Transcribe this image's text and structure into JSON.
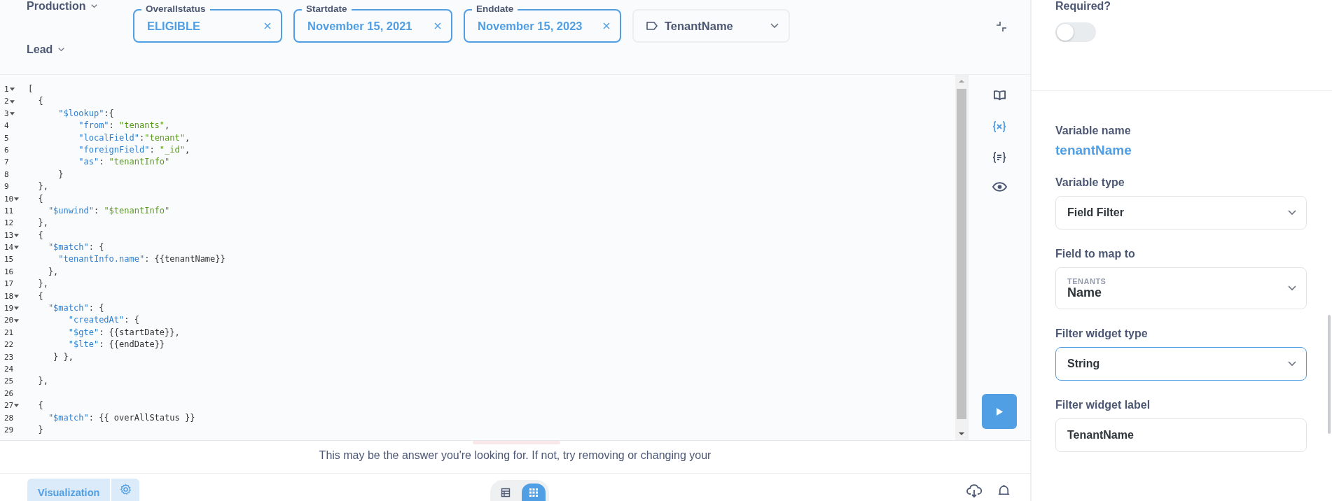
{
  "sidebar_filters": [
    {
      "label": "Production"
    },
    {
      "label": "Lead"
    }
  ],
  "filter_widgets": [
    {
      "kind": "chip",
      "label": "Overallstatus",
      "value": "ELIGIBLE"
    },
    {
      "kind": "chip",
      "label": "Startdate",
      "value": "November 15, 2021"
    },
    {
      "kind": "chip",
      "label": "Enddate",
      "value": "November 15, 2023"
    },
    {
      "kind": "dropdown",
      "value": "TenantName"
    }
  ],
  "editor": {
    "lines": [
      {
        "number": "1",
        "fold": true,
        "tokens": [
          {
            "kind": "punct",
            "text": "["
          }
        ]
      },
      {
        "number": "2",
        "fold": true,
        "tokens": [
          {
            "kind": "punct",
            "text": "  {"
          }
        ]
      },
      {
        "number": "3",
        "fold": true,
        "tokens": [
          {
            "kind": "key",
            "text": "      \"$lookup\""
          },
          {
            "kind": "punct",
            "text": ":{"
          }
        ]
      },
      {
        "number": "4",
        "fold": false,
        "tokens": [
          {
            "kind": "key",
            "text": "          \"from\""
          },
          {
            "kind": "punct",
            "text": ": "
          },
          {
            "kind": "string",
            "text": "\"tenants\""
          },
          {
            "kind": "punct",
            "text": ","
          }
        ]
      },
      {
        "number": "5",
        "fold": false,
        "tokens": [
          {
            "kind": "key",
            "text": "          \"localField\""
          },
          {
            "kind": "punct",
            "text": ":"
          },
          {
            "kind": "string",
            "text": "\"tenant\""
          },
          {
            "kind": "punct",
            "text": ","
          }
        ]
      },
      {
        "number": "6",
        "fold": false,
        "tokens": [
          {
            "kind": "key",
            "text": "          \"foreignField\""
          },
          {
            "kind": "punct",
            "text": ": "
          },
          {
            "kind": "string",
            "text": "\"_id\""
          },
          {
            "kind": "punct",
            "text": ","
          }
        ]
      },
      {
        "number": "7",
        "fold": false,
        "tokens": [
          {
            "kind": "key",
            "text": "          \"as\""
          },
          {
            "kind": "punct",
            "text": ": "
          },
          {
            "kind": "string",
            "text": "\"tenantInfo\""
          }
        ]
      },
      {
        "number": "8",
        "fold": false,
        "tokens": [
          {
            "kind": "punct",
            "text": "      }"
          }
        ]
      },
      {
        "number": "9",
        "fold": false,
        "tokens": [
          {
            "kind": "punct",
            "text": "  },"
          }
        ]
      },
      {
        "number": "10",
        "fold": true,
        "tokens": [
          {
            "kind": "punct",
            "text": "  {"
          }
        ]
      },
      {
        "number": "11",
        "fold": false,
        "tokens": [
          {
            "kind": "key",
            "text": "    \"$unwind\""
          },
          {
            "kind": "punct",
            "text": ": "
          },
          {
            "kind": "string",
            "text": "\"$tenantInfo\""
          }
        ]
      },
      {
        "number": "12",
        "fold": false,
        "tokens": [
          {
            "kind": "punct",
            "text": "  },"
          }
        ]
      },
      {
        "number": "13",
        "fold": true,
        "tokens": [
          {
            "kind": "punct",
            "text": "  {"
          }
        ]
      },
      {
        "number": "14",
        "fold": true,
        "tokens": [
          {
            "kind": "key",
            "text": "    \"$match\""
          },
          {
            "kind": "punct",
            "text": ": {"
          }
        ]
      },
      {
        "number": "15",
        "fold": false,
        "tokens": [
          {
            "kind": "key",
            "text": "      \"tenantInfo.name\""
          },
          {
            "kind": "punct",
            "text": ": {{tenantName}}"
          }
        ]
      },
      {
        "number": "16",
        "fold": false,
        "tokens": [
          {
            "kind": "punct",
            "text": "    },"
          }
        ]
      },
      {
        "number": "17",
        "fold": false,
        "tokens": [
          {
            "kind": "punct",
            "text": "  },"
          }
        ]
      },
      {
        "number": "18",
        "fold": true,
        "tokens": [
          {
            "kind": "punct",
            "text": "  {"
          }
        ]
      },
      {
        "number": "19",
        "fold": true,
        "tokens": [
          {
            "kind": "key",
            "text": "    \"$match\""
          },
          {
            "kind": "punct",
            "text": ": {"
          }
        ]
      },
      {
        "number": "20",
        "fold": true,
        "tokens": [
          {
            "kind": "key",
            "text": "        \"createdAt\""
          },
          {
            "kind": "punct",
            "text": ": {"
          }
        ]
      },
      {
        "number": "21",
        "fold": false,
        "tokens": [
          {
            "kind": "key",
            "text": "        \"$gte\""
          },
          {
            "kind": "punct",
            "text": ": {{startDate}},"
          }
        ]
      },
      {
        "number": "22",
        "fold": false,
        "tokens": [
          {
            "kind": "key",
            "text": "        \"$lte\""
          },
          {
            "kind": "punct",
            "text": ": {{endDate}}"
          }
        ]
      },
      {
        "number": "23",
        "fold": false,
        "tokens": [
          {
            "kind": "punct",
            "text": "     } },"
          }
        ]
      },
      {
        "number": "24",
        "fold": false
      },
      {
        "number": "25",
        "fold": false,
        "tokens": [
          {
            "kind": "punct",
            "text": "  },"
          }
        ]
      },
      {
        "number": "26",
        "fold": false
      },
      {
        "number": "27",
        "fold": true,
        "tokens": [
          {
            "kind": "punct",
            "text": "  {"
          }
        ]
      },
      {
        "number": "28",
        "fold": false,
        "tokens": [
          {
            "kind": "key",
            "text": "    \"$match\""
          },
          {
            "kind": "punct",
            "text": ": {{ overAllStatus }}"
          }
        ]
      },
      {
        "number": "29",
        "fold": false,
        "tokens": [
          {
            "kind": "punct",
            "text": "  }"
          }
        ]
      }
    ]
  },
  "tools": [
    {
      "kind": "book",
      "selected": false
    },
    {
      "kind": "variables",
      "selected": true
    },
    {
      "kind": "snippets",
      "selected": false
    },
    {
      "kind": "preview",
      "selected": false
    }
  ],
  "message": "This may be the answer you're looking for. If not, try removing or changing your",
  "bottom_bar": {
    "visualization_button": "Visualization",
    "view_toggle": [
      {
        "kind": "table",
        "selected": false
      },
      {
        "kind": "grid",
        "selected": true
      }
    ]
  },
  "variable_panel": {
    "required": {
      "label": "Required?",
      "on": false
    },
    "variable_name": {
      "label": "Variable name",
      "value": "tenantName"
    },
    "fields": [
      {
        "kind": "select",
        "label": "Variable type",
        "value": "Field Filter",
        "focused": false
      },
      {
        "kind": "select",
        "label": "Field to map to",
        "table": "TENANTS",
        "value": "Name",
        "focused": false
      },
      {
        "kind": "select",
        "label": "Filter widget type",
        "value": "String",
        "focused": true
      },
      {
        "kind": "input",
        "label": "Filter widget label",
        "value": "TenantName",
        "focused": false
      }
    ]
  }
}
